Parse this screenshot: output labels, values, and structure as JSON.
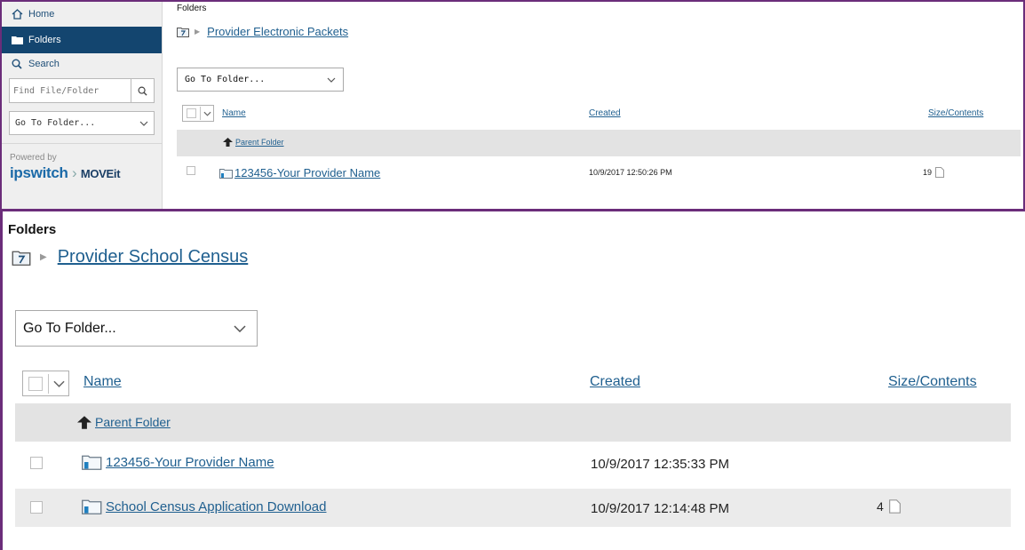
{
  "sidebar": {
    "home_label": "Home",
    "folders_label": "Folders",
    "search_label": "Search",
    "find_placeholder": "Find File/Folder",
    "goto_label": "Go To Folder...",
    "powered_by": "Powered by",
    "brand_main": "ipswitch",
    "brand_product": "MOVEit"
  },
  "top": {
    "title": "Folders",
    "breadcrumb": "Provider Electronic Packets",
    "goto_label": "Go To Folder...",
    "columns": {
      "name": "Name",
      "created": "Created",
      "size": "Size/Contents"
    },
    "parent_label": "Parent Folder",
    "rows": [
      {
        "name": "123456-Your Provider Name",
        "created": "10/9/2017 12:50:26 PM",
        "size": "19"
      }
    ]
  },
  "bottom": {
    "title": "Folders",
    "breadcrumb": "Provider School Census",
    "goto_label": "Go To Folder...",
    "columns": {
      "name": "Name",
      "created": "Created",
      "size": "Size/Contents"
    },
    "parent_label": "Parent Folder",
    "rows": [
      {
        "name": "123456-Your Provider Name",
        "created": "10/9/2017 12:35:33 PM",
        "size": ""
      },
      {
        "name": "School Census Application Download",
        "created": "10/9/2017 12:14:48 PM",
        "size": "4"
      }
    ]
  },
  "colors": {
    "accent_border": "#6b2d7a",
    "sidebar_active": "#13456f",
    "link": "#1f5f8f",
    "row_alt": "#ebebeb"
  }
}
